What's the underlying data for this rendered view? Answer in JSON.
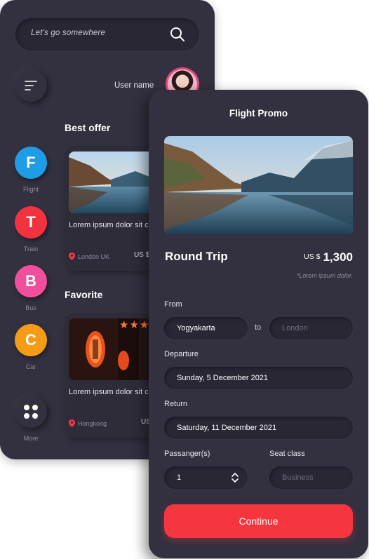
{
  "search": {
    "placeholder": "Let's go somewhere"
  },
  "user": {
    "name": "User name"
  },
  "categories": [
    {
      "letter": "F",
      "label": "Flight",
      "color": "#1e9ce6"
    },
    {
      "letter": "T",
      "label": "Train",
      "color": "#f2323e"
    },
    {
      "letter": "B",
      "label": "Bus",
      "color": "#ef4f9c"
    },
    {
      "letter": "C",
      "label": "Car",
      "color": "#f59c16"
    }
  ],
  "more": {
    "label": "More"
  },
  "best_offer": {
    "title": "Best offer",
    "card": {
      "text": "Lorem ipsum dolor sit consectetur",
      "location": "London UK",
      "price": "US $"
    }
  },
  "favorite": {
    "title": "Favorite",
    "card": {
      "text": "Lorem ipsum dolor sit consectetur",
      "location": "Hongkong",
      "price": "US"
    }
  },
  "flight_promo": {
    "title": "Flight Promo",
    "trip_type": "Round Trip",
    "currency": "US $",
    "price": "1,300",
    "note": "*Lorem ipsum dolor.",
    "from_label": "From",
    "from_value": "Yogyakarta",
    "to_label": "to",
    "to_placeholder": "London",
    "departure_label": "Departure",
    "departure_value": "Sunday, 5 December 2021",
    "return_label": "Return",
    "return_value": "Saturday, 11 December 2021",
    "passenger_label": "Passanger(s)",
    "passenger_value": "1",
    "seat_label": "Seat class",
    "seat_placeholder": "Business",
    "continue_label": "Continue"
  },
  "colors": {
    "background": "#33303f",
    "accent": "#f5363f",
    "star": "#f57a3a"
  }
}
